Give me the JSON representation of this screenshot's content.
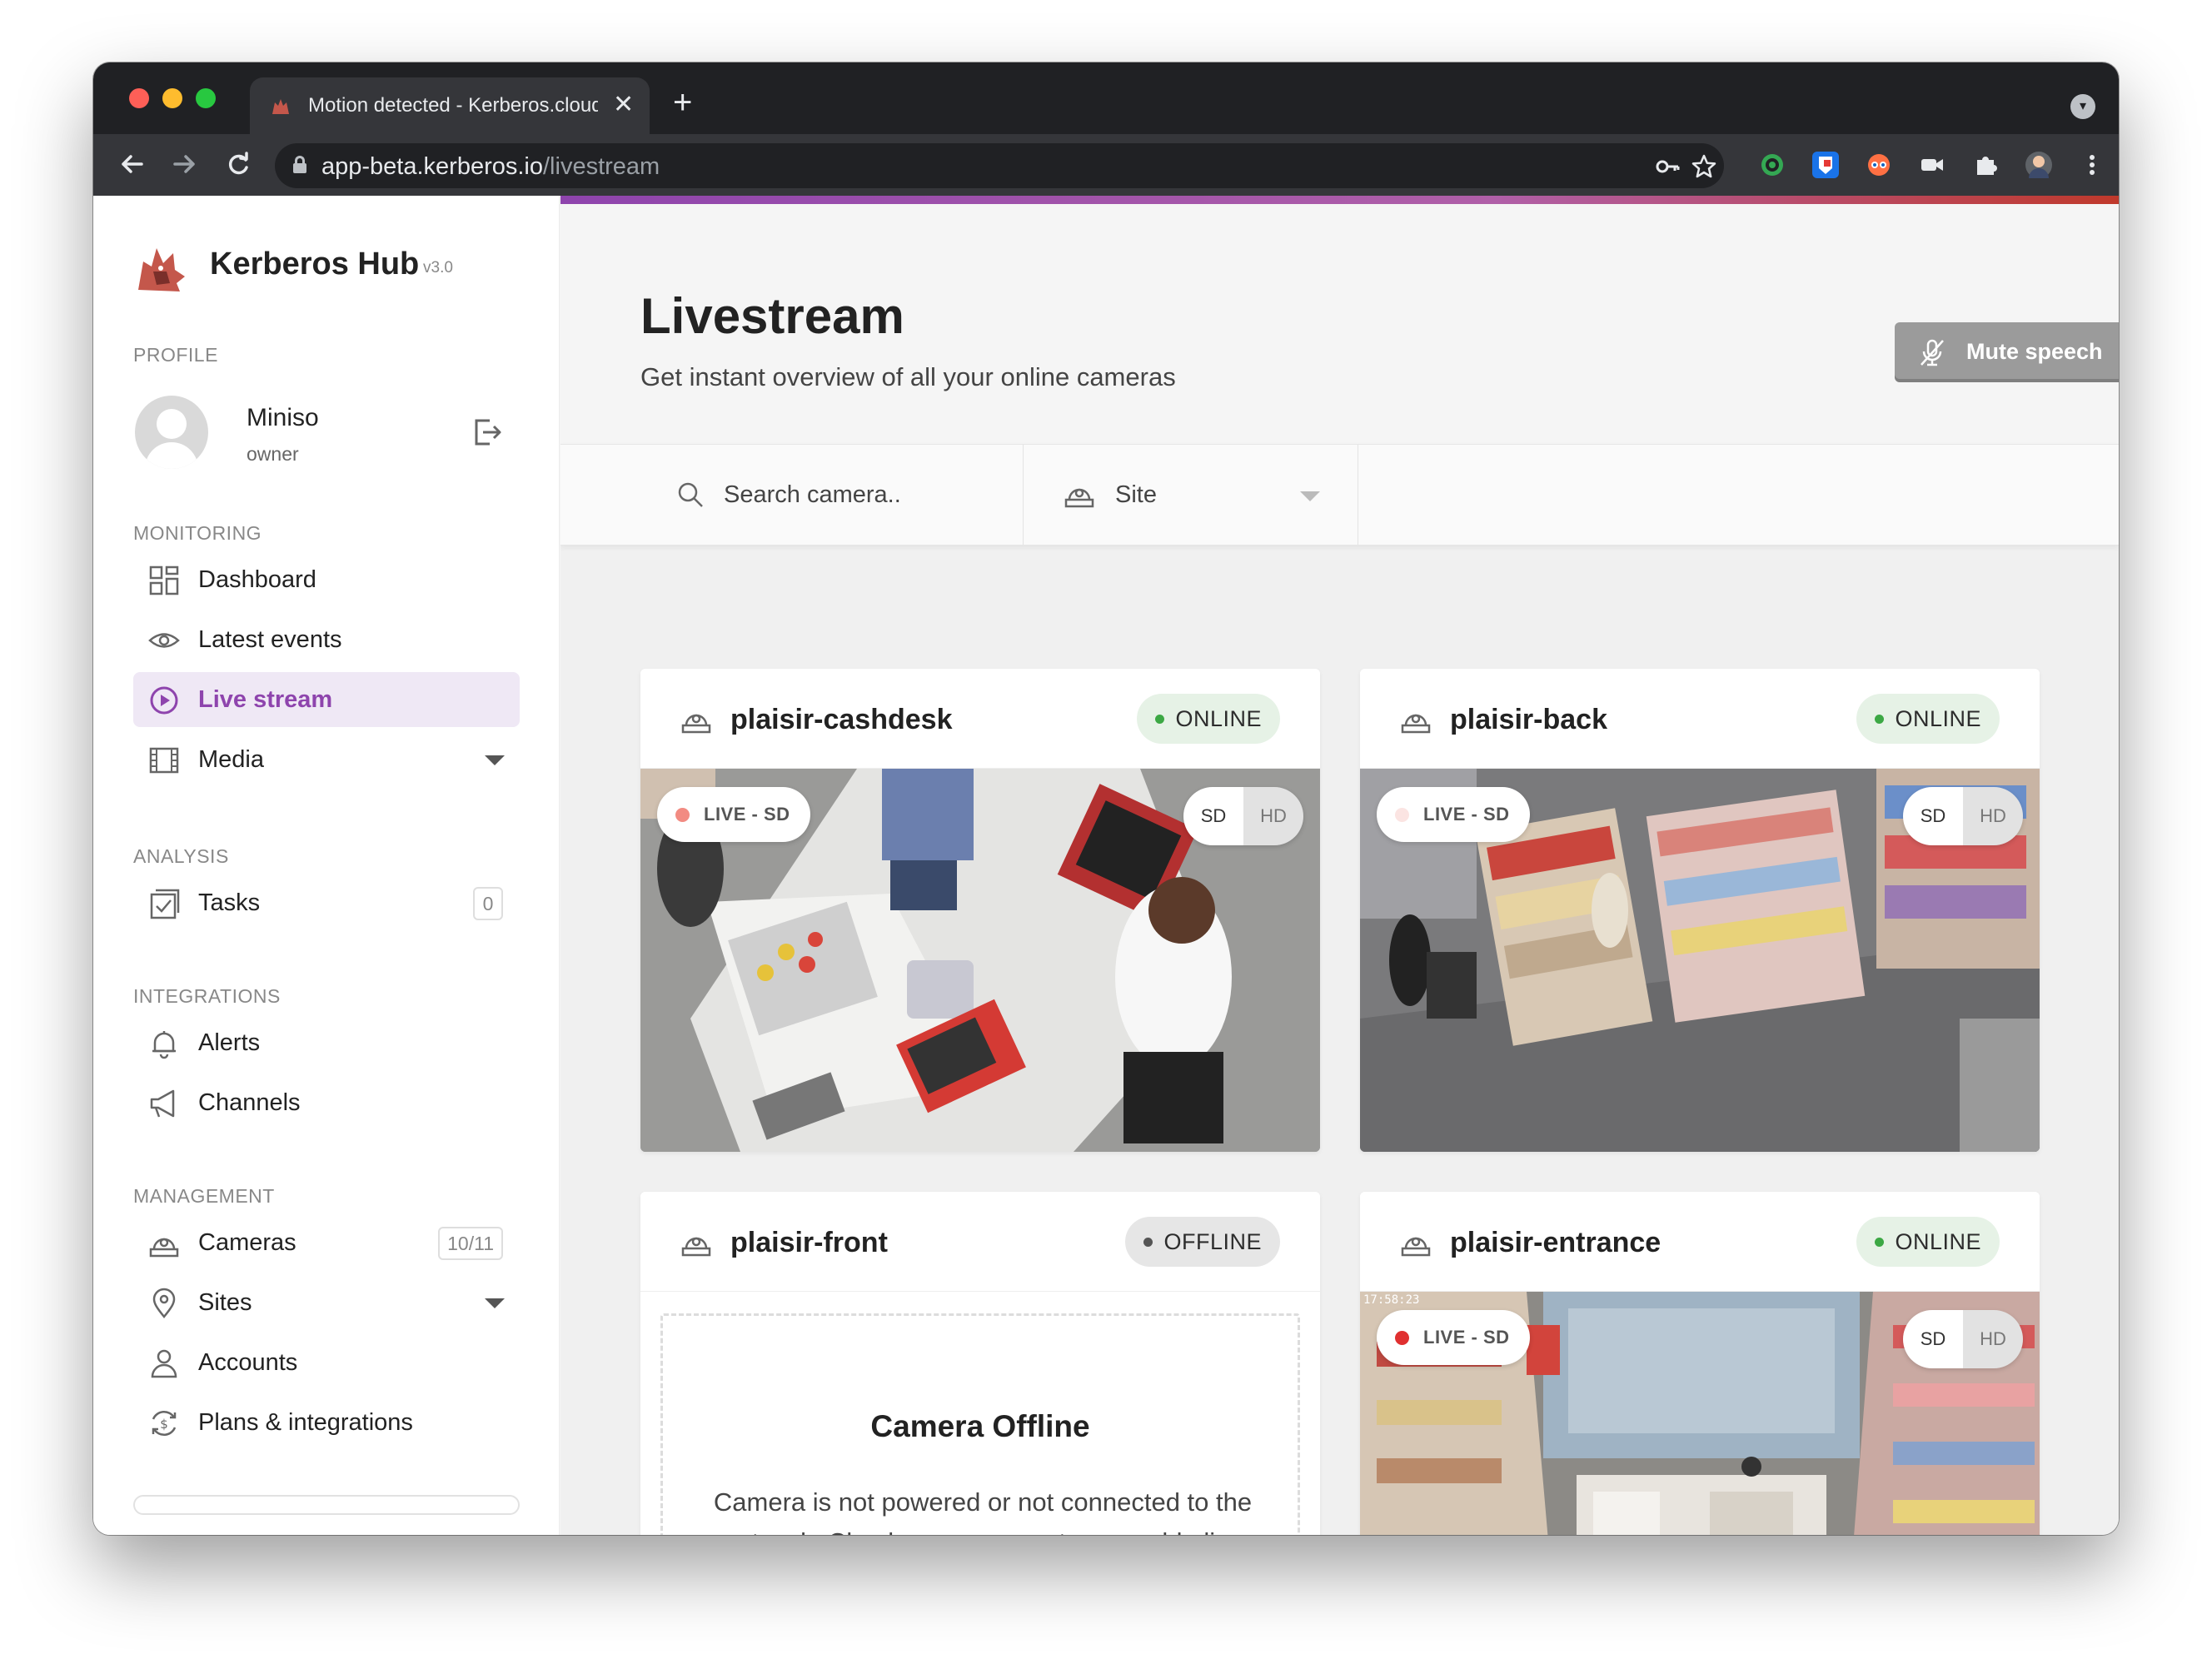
{
  "browser": {
    "tab_title": "Motion detected - Kerberos.cloud",
    "tab_close": "✕",
    "new_tab": "+",
    "url_host": "app-beta.kerberos.io",
    "url_path": "/livestream",
    "icons": [
      "back-icon",
      "forward-icon",
      "reload-icon",
      "lock-icon",
      "key-icon",
      "star-icon",
      "extension-icon",
      "profile-avatar-icon",
      "more-icon"
    ]
  },
  "sidebar": {
    "brand": {
      "name": "Kerberos Hub",
      "version": "v3.0"
    },
    "profile_label": "PROFILE",
    "user": {
      "name": "Miniso",
      "role": "owner"
    },
    "monitoring_label": "MONITORING",
    "monitoring_items": [
      {
        "label": "Dashboard",
        "icon": "dashboard-icon"
      },
      {
        "label": "Latest events",
        "icon": "eye-icon"
      },
      {
        "label": "Live stream",
        "icon": "play-circle-icon",
        "active": true
      },
      {
        "label": "Media",
        "icon": "film-icon"
      }
    ],
    "analysis_label": "ANALYSIS",
    "analysis_items": [
      {
        "label": "Tasks",
        "icon": "tasks-icon",
        "count": "0"
      }
    ],
    "integrations_label": "INTEGRATIONS",
    "integrations_items": [
      {
        "label": "Alerts",
        "icon": "bell-icon"
      },
      {
        "label": "Channels",
        "icon": "megaphone-icon"
      }
    ],
    "management_label": "MANAGEMENT",
    "management_items": [
      {
        "label": "Cameras",
        "icon": "camera-icon",
        "count": "10/11"
      },
      {
        "label": "Sites",
        "icon": "location-pin-icon"
      },
      {
        "label": "Accounts",
        "icon": "user-icon"
      },
      {
        "label": "Plans & integrations",
        "icon": "plans-icon"
      }
    ]
  },
  "header": {
    "title": "Livestream",
    "subtitle": "Get instant overview of all your online cameras",
    "mute_button": "Mute speech"
  },
  "filters": {
    "search_placeholder": "Search camera..",
    "site_label": "Site"
  },
  "cameras": [
    {
      "name": "plaisir-cashdesk",
      "status": "ONLINE",
      "live_label": "LIVE - SD",
      "sd": "SD",
      "hd": "HD"
    },
    {
      "name": "plaisir-back",
      "status": "ONLINE",
      "live_label": "LIVE - SD",
      "sd": "SD",
      "hd": "HD"
    },
    {
      "name": "plaisir-front",
      "status": "OFFLINE",
      "offline_title": "Camera Offline",
      "offline_text": "Camera is not powered or not connected to the network. Check your camera to re-enable live stream and event recording."
    },
    {
      "name": "plaisir-entrance",
      "status": "ONLINE",
      "live_label": "LIVE - SD",
      "sd": "SD",
      "hd": "HD",
      "timestamp": "17:58:23"
    }
  ],
  "colors": {
    "accent": "#8e44ad",
    "online": "#3ca844",
    "live_dot": "#e03030",
    "button_gray": "#9b9b9b"
  }
}
